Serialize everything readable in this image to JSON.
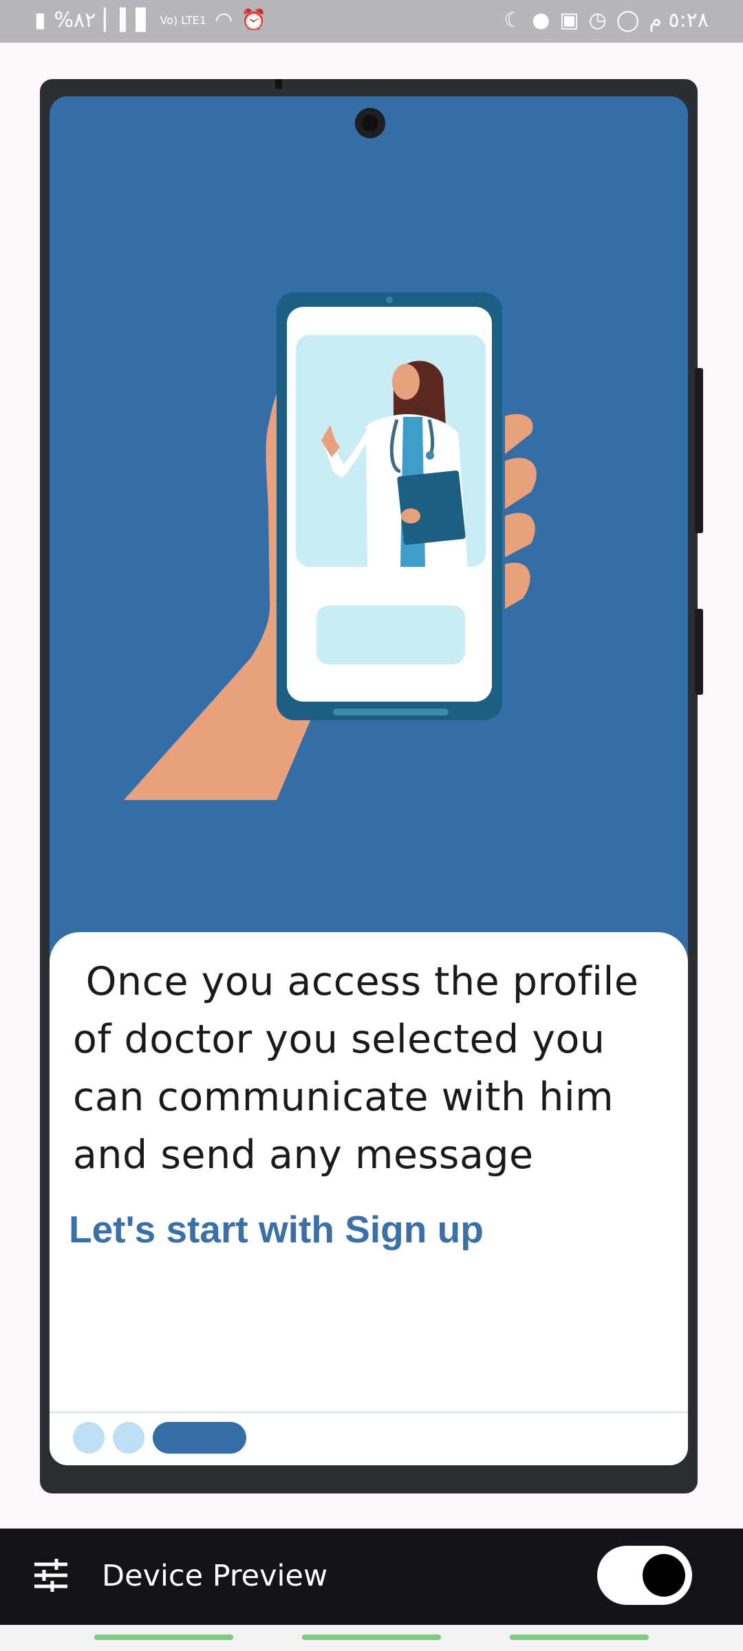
{
  "status_bar": {
    "battery": "%٨٢",
    "network": "Vo) LTE1",
    "time": "٥:٢٨ م",
    "icons_left": [
      "battery-charging-icon",
      "signal-icon",
      "volte-icon",
      "wifi-icon",
      "alarm-icon"
    ],
    "icons_right": [
      "moon-icon",
      "app-icon",
      "image-icon",
      "alarm-icon",
      "whatsapp-icon"
    ]
  },
  "onboarding": {
    "body_text": " Once you access the profile\nof doctor you selected you\ncan communicate with him\nand send any message",
    "signup_link": "Let's start with Sign up",
    "page_indicator": {
      "total": 3,
      "active": 3
    }
  },
  "preview_bar": {
    "title": "Device Preview",
    "toggle_on": true
  },
  "colors": {
    "primary": "#346ea7",
    "link": "#3a6fa7",
    "dot_inactive": "#bfdff5",
    "skin": "#e9a07d"
  }
}
